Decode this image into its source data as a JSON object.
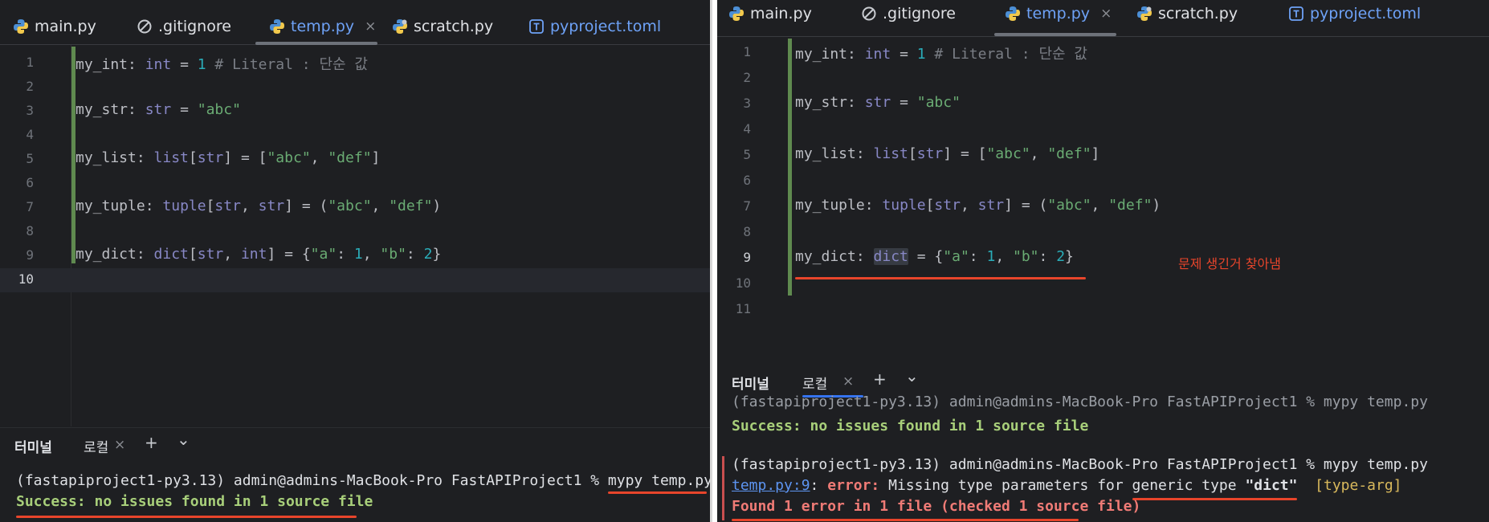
{
  "tabs": [
    {
      "label": "main.py",
      "icon": "python-icon"
    },
    {
      "label": ".gitignore",
      "icon": "ignore-icon"
    },
    {
      "label": "temp.py",
      "icon": "python-icon",
      "active": true
    },
    {
      "label": "scratch.py",
      "icon": "python-scratch-icon"
    },
    {
      "label": "pyproject.toml",
      "icon": "toml-icon"
    }
  ],
  "tab_close": "×",
  "left": {
    "line_numbers": [
      "1",
      "2",
      "3",
      "4",
      "5",
      "6",
      "7",
      "8",
      "9",
      "10"
    ],
    "code": {
      "l1": {
        "var": "my_int",
        "colon": ": ",
        "type": "int",
        "eq": " = ",
        "val": "1",
        "comment": " # Literal : 단순 값"
      },
      "l3": {
        "var": "my_str",
        "colon": ": ",
        "type": "str",
        "eq": " = ",
        "val": "\"abc\""
      },
      "l5": {
        "var": "my_list",
        "colon": ": ",
        "type": "list",
        "lb": "[",
        "t1": "str",
        "rb": "]",
        "eq": " = [",
        "v1": "\"abc\"",
        "c": ", ",
        "v2": "\"def\"",
        "end": "]"
      },
      "l7": {
        "var": "my_tuple",
        "colon": ": ",
        "type": "tuple",
        "lb": "[",
        "t1": "str",
        "c1": ", ",
        "t2": "str",
        "rb": "]",
        "eq": " = (",
        "v1": "\"abc\"",
        "c": ", ",
        "v2": "\"def\"",
        "end": ")"
      },
      "l9": {
        "var": "my_dict",
        "colon": ": ",
        "type": "dict",
        "lb": "[",
        "t1": "str",
        "c1": ", ",
        "t2": "int",
        "rb": "]",
        "eq": " = {",
        "k1": "\"a\"",
        "s1": ": ",
        "n1": "1",
        "c": ", ",
        "k2": "\"b\"",
        "s2": ": ",
        "n2": "2",
        "end": "}"
      }
    },
    "terminal": {
      "title": "터미널",
      "tab": "로컬",
      "close": "×",
      "plus": "+",
      "chevron": "⌄",
      "prompt": "(fastapiproject1-py3.13) admin@admins-MacBook-Pro FastAPIProject1 % ",
      "command": "mypy temp.py",
      "success": "Success: no issues found in 1 source file"
    }
  },
  "right": {
    "line_numbers": [
      "1",
      "2",
      "3",
      "4",
      "5",
      "6",
      "7",
      "8",
      "9",
      "10",
      "11"
    ],
    "code": {
      "l1": {
        "var": "my_int",
        "colon": ": ",
        "type": "int",
        "eq": " = ",
        "val": "1",
        "comment": " # Literal : 단순 값"
      },
      "l3": {
        "var": "my_str",
        "colon": ": ",
        "type": "str",
        "eq": " = ",
        "val": "\"abc\""
      },
      "l5": {
        "var": "my_list",
        "colon": ": ",
        "type": "list",
        "lb": "[",
        "t1": "str",
        "rb": "]",
        "eq": " = [",
        "v1": "\"abc\"",
        "c": ", ",
        "v2": "\"def\"",
        "end": "]"
      },
      "l7": {
        "var": "my_tuple",
        "colon": ": ",
        "type": "tuple",
        "lb": "[",
        "t1": "str",
        "c1": ", ",
        "t2": "str",
        "rb": "]",
        "eq": " = (",
        "v1": "\"abc\"",
        "c": ", ",
        "v2": "\"def\"",
        "end": ")"
      },
      "l9": {
        "var": "my_dict",
        "colon": ": ",
        "type": "dict",
        "eq": " = {",
        "k1": "\"a\"",
        "s1": ": ",
        "n1": "1",
        "c": ", ",
        "k2": "\"b\"",
        "s2": ": ",
        "n2": "2",
        "end": "}"
      }
    },
    "annotation": "문제 생긴거 찾아냄",
    "terminal": {
      "title": "터미널",
      "tab": "로컬",
      "close": "×",
      "plus": "+",
      "chevron": "⌄",
      "ghost_line": "(fastapiproject1-py3.13) admin@admins-MacBook-Pro FastAPIProject1 % mypy temp.py",
      "success": "Success: no issues found in 1 source file",
      "prompt": "(fastapiproject1-py3.13) admin@admins-MacBook-Pro FastAPIProject1 % mypy temp.py",
      "err_loc": "temp.py:9",
      "err_sep": ": ",
      "err_word": "error:",
      "err_msg": " Missing type parameters for ",
      "err_generic": "generic type",
      "err_space": " ",
      "err_dict": "\"dict\"",
      "err_tag": "  [type-arg]",
      "err_summary": "Found 1 error in 1 file (checked 1 source file)"
    }
  },
  "colors": {
    "background": "#1e1f22",
    "active_tab": "#6ea2f7",
    "success": "#a8cf7a",
    "error": "#f07b76",
    "annotation_red": "#e8452b"
  }
}
